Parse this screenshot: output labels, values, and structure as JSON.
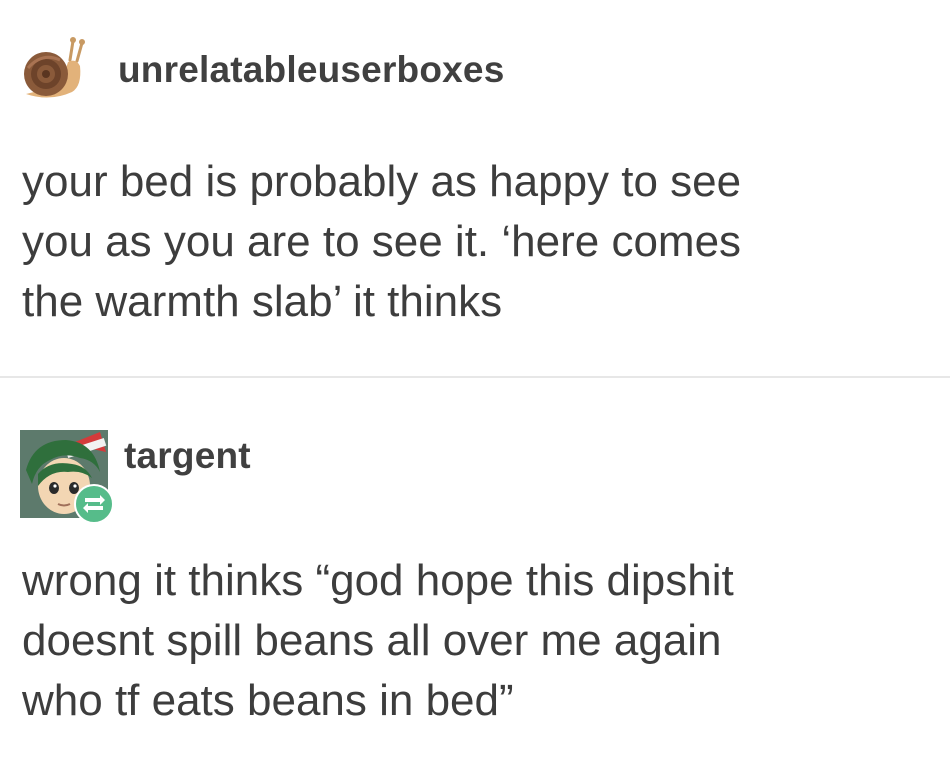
{
  "posts": [
    {
      "username": "unrelatableuserboxes",
      "avatar_icon": "snail-icon",
      "lines": [
        "your bed is probably as happy to see",
        "you as you are to see it. ‘here comes",
        "the warmth slab’ it thinks"
      ]
    },
    {
      "username": "targent",
      "avatar_icon": "green-haired-character-avatar",
      "badge_icon": "reblog-icon",
      "lines": [
        "wrong it thinks “god hope this dipshit",
        "doesnt spill beans all over me again",
        "who tf eats beans in bed”"
      ]
    }
  ],
  "colors": {
    "text": "#3d3d3d",
    "divider": "#e7e7e7",
    "reblog_badge": "#56bc8a"
  }
}
